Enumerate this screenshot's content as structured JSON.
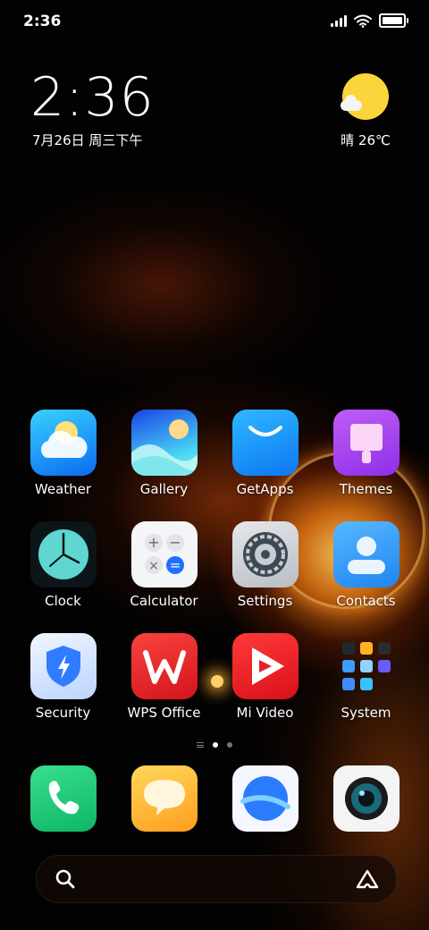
{
  "status_bar": {
    "time": "2:36",
    "icons": [
      "signal-icon",
      "wifi-icon",
      "battery-icon"
    ],
    "battery_level": 0.85
  },
  "clock_widget": {
    "time": "2:36",
    "date": "7月26日 周三下午"
  },
  "weather_widget": {
    "icon": "sunny-cloud-icon",
    "text": "晴 26℃"
  },
  "apps": [
    {
      "label": "Weather",
      "icon": "weather-icon"
    },
    {
      "label": "Gallery",
      "icon": "gallery-icon"
    },
    {
      "label": "GetApps",
      "icon": "getapps-icon"
    },
    {
      "label": "Themes",
      "icon": "themes-icon"
    },
    {
      "label": "Clock",
      "icon": "clock-icon"
    },
    {
      "label": "Calculator",
      "icon": "calculator-icon"
    },
    {
      "label": "Settings",
      "icon": "settings-gear-icon"
    },
    {
      "label": "Contacts",
      "icon": "contacts-icon"
    },
    {
      "label": "Security",
      "icon": "security-shield-icon"
    },
    {
      "label": "WPS Office",
      "icon": "wps-office-icon"
    },
    {
      "label": "Mi Video",
      "icon": "mi-video-icon"
    },
    {
      "label": "System",
      "icon": "system-folder-icon"
    }
  ],
  "page_indicator": {
    "pages": 2,
    "active": 1
  },
  "dock": [
    {
      "name": "phone",
      "icon": "phone-icon"
    },
    {
      "name": "messages",
      "icon": "messages-icon"
    },
    {
      "name": "browser",
      "icon": "browser-icon"
    },
    {
      "name": "camera",
      "icon": "camera-icon"
    }
  ],
  "search_bar": {
    "left_icon": "search-icon",
    "right_icon": "assistant-icon"
  },
  "colors": {
    "accent_weather": "#0a6cf0",
    "sun": "#fcd43b",
    "wallpaper_glow": "#ff9a2a"
  }
}
